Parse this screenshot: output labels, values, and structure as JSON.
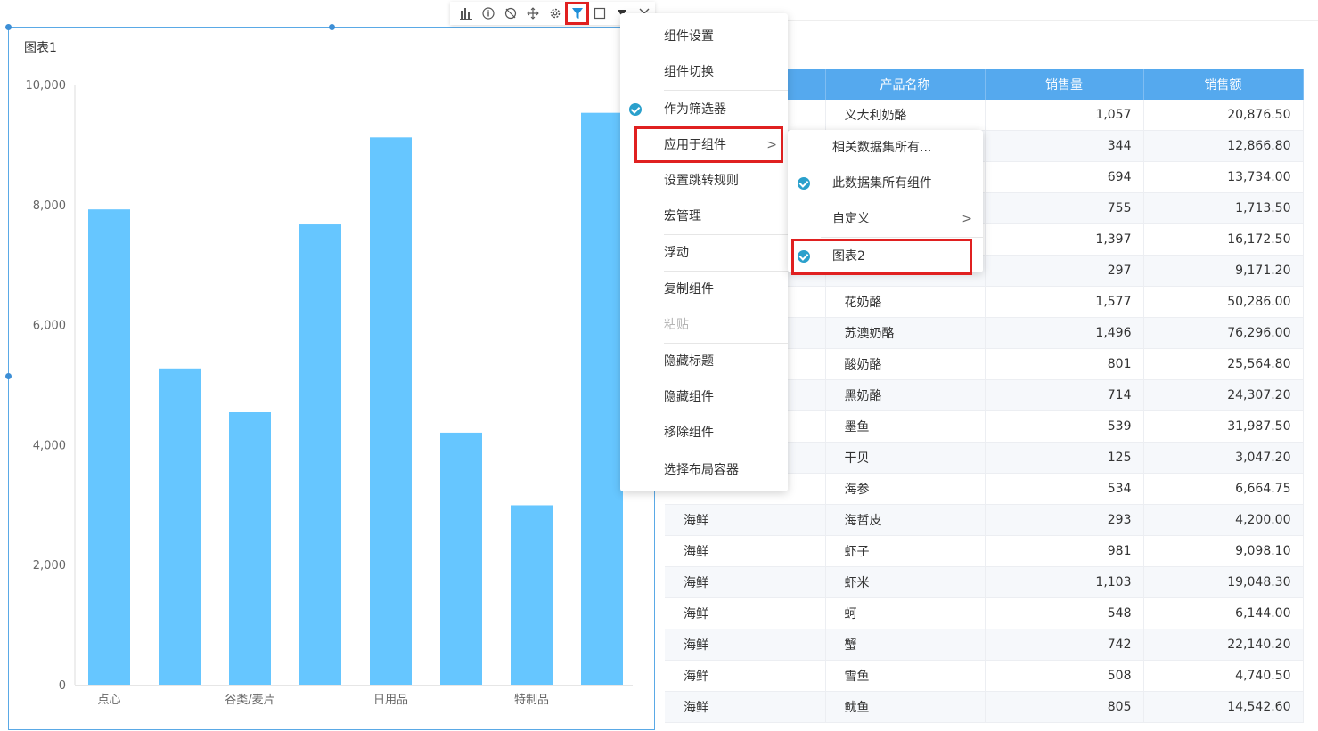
{
  "toolbar": {
    "icons": [
      "chart-type-icon",
      "info-icon",
      "link-off-icon",
      "move-icon",
      "settings-icon",
      "filter-icon",
      "maximize-icon",
      "dropdown-icon",
      "close-icon"
    ],
    "active": "filter-icon",
    "highlight_color": "#e02020"
  },
  "chart": {
    "title": "图表1",
    "accent": "#66c6ff"
  },
  "chart_data": {
    "type": "bar",
    "categories": [
      "点心",
      "",
      "谷类/麦片",
      "",
      "日用品",
      "",
      "特制品",
      ""
    ],
    "values": [
      7920,
      5270,
      4540,
      7670,
      9120,
      4200,
      2990,
      9530
    ],
    "title": "图表1",
    "xlabel": "",
    "ylabel": "",
    "ylim": [
      0,
      10000
    ],
    "yticks": [
      "10,000",
      "8,000",
      "6,000",
      "4,000",
      "2,000",
      "0"
    ],
    "grid": false,
    "color": "#66c6ff"
  },
  "table": {
    "headers": [
      "",
      "产品名称",
      "销售量",
      "销售额"
    ],
    "header_color": "#55a9ee",
    "rows": [
      [
        "",
        "义大利奶酪",
        "1,057",
        "20,876.50"
      ],
      [
        "",
        "",
        "344",
        "12,866.80"
      ],
      [
        "",
        "",
        "694",
        "13,734.00"
      ],
      [
        "",
        "",
        "755",
        "1,713.50"
      ],
      [
        "",
        "",
        "1,397",
        "16,172.50"
      ],
      [
        "",
        "",
        "297",
        "9,171.20"
      ],
      [
        "",
        "花奶酪",
        "1,577",
        "50,286.00"
      ],
      [
        "",
        "苏澳奶酪",
        "1,496",
        "76,296.00"
      ],
      [
        "",
        "酸奶酪",
        "801",
        "25,564.80"
      ],
      [
        "",
        "黑奶酪",
        "714",
        "24,307.20"
      ],
      [
        "",
        "墨鱼",
        "539",
        "31,987.50"
      ],
      [
        "",
        "干贝",
        "125",
        "3,047.20"
      ],
      [
        "",
        "海参",
        "534",
        "6,664.75"
      ],
      [
        "海鲜",
        "海哲皮",
        "293",
        "4,200.00"
      ],
      [
        "海鲜",
        "虾子",
        "981",
        "9,098.10"
      ],
      [
        "海鲜",
        "虾米",
        "1,103",
        "19,048.30"
      ],
      [
        "海鲜",
        "蚵",
        "548",
        "6,144.00"
      ],
      [
        "海鲜",
        "蟹",
        "742",
        "22,140.20"
      ],
      [
        "海鲜",
        "雪鱼",
        "508",
        "4,740.50"
      ],
      [
        "海鲜",
        "鱿鱼",
        "805",
        "14,542.60"
      ]
    ]
  },
  "context_menu": {
    "items": [
      {
        "label": "组件设置"
      },
      {
        "label": "组件切换"
      },
      {
        "label": "作为筛选器",
        "checked": true
      },
      {
        "label": "应用于组件",
        "submenu": true,
        "highlighted": true
      },
      {
        "label": "设置跳转规则"
      },
      {
        "label": "宏管理"
      },
      {
        "label": "浮动"
      },
      {
        "label": "复制组件"
      },
      {
        "label": "粘贴",
        "disabled": true
      },
      {
        "label": "隐藏标题"
      },
      {
        "label": "隐藏组件"
      },
      {
        "label": "移除组件"
      },
      {
        "label": "选择布局容器"
      }
    ],
    "arrow": ">"
  },
  "sub_menu": {
    "items": [
      {
        "label": "相关数据集所有..."
      },
      {
        "label": "此数据集所有组件",
        "checked": true
      },
      {
        "label": "自定义",
        "submenu": true
      },
      {
        "label": "图表2",
        "checked": true,
        "highlighted": true
      }
    ],
    "arrow": ">",
    "check_color": "#2aa0cc"
  }
}
